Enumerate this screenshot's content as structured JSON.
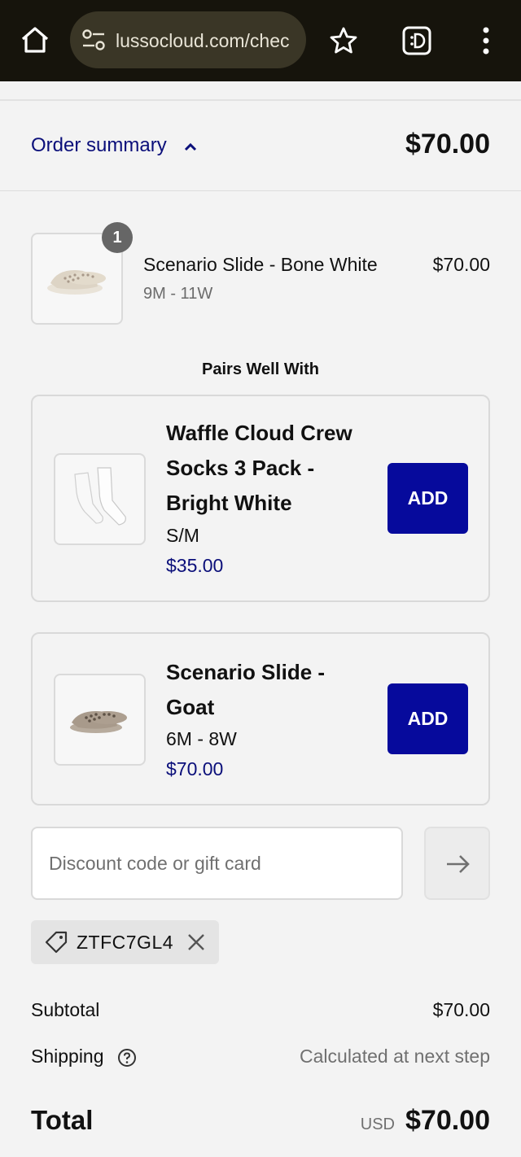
{
  "browser": {
    "url": "lussocloud.com/chec",
    "icons": [
      "home-icon",
      "site-settings-icon",
      "bookmark-star-icon",
      "tab-switcher-icon",
      "more-menu-icon"
    ]
  },
  "summary": {
    "toggle_label": "Order summary",
    "total": "$70.00"
  },
  "cart_item": {
    "quantity": "1",
    "name": "Scenario Slide - Bone White",
    "variant": "9M - 11W",
    "price": "$70.00"
  },
  "pairs_well_with": {
    "title": "Pairs Well With",
    "items": [
      {
        "title_lines": [
          "Waffle Cloud Crew",
          "Socks 3 Pack -",
          "Bright White"
        ],
        "variant": "S/M",
        "price": "$35.00",
        "button_label": "ADD"
      },
      {
        "title_lines": [
          "Scenario Slide -",
          "Goat"
        ],
        "variant": "6M - 8W",
        "price": "$70.00",
        "button_label": "ADD"
      }
    ]
  },
  "discount": {
    "placeholder": "Discount code or gift card",
    "applied_code": "ZTFC7GL4"
  },
  "totals": {
    "subtotal_label": "Subtotal",
    "subtotal_value": "$70.00",
    "shipping_label": "Shipping",
    "shipping_value": "Calculated at next step",
    "total_label": "Total",
    "currency": "USD",
    "total_value": "$70.00"
  },
  "colors": {
    "accent": "#060a9c",
    "link": "#0b0f7a",
    "browser_bar": "#16140c"
  }
}
